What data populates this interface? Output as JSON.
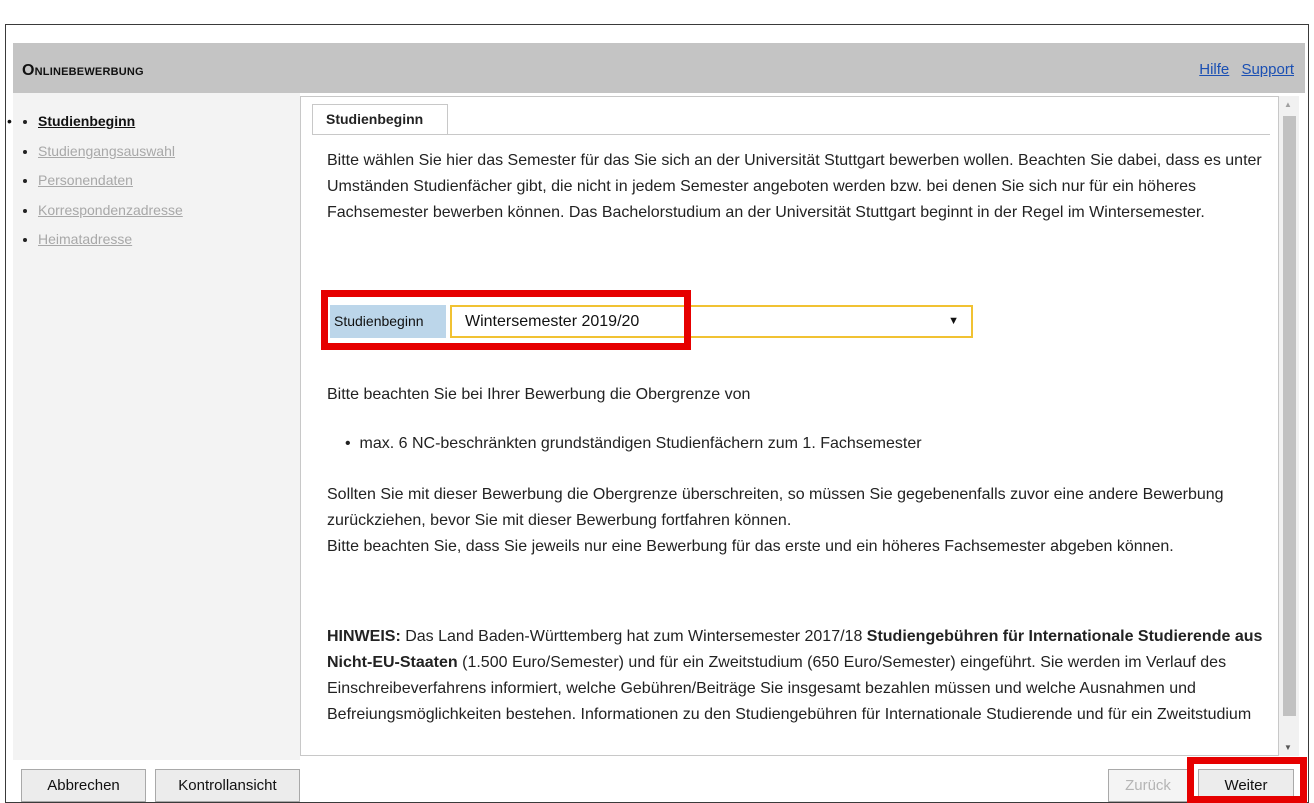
{
  "app": {
    "title": "Onlinebewerbung"
  },
  "links": {
    "help": "Hilfe",
    "support": "Support"
  },
  "sidebar": {
    "bullet": "•",
    "items": [
      {
        "label": "Studienbeginn",
        "state": "active"
      },
      {
        "label": "Studiengangsauswahl",
        "state": "inactive"
      },
      {
        "label": "Personendaten",
        "state": "inactive"
      },
      {
        "label": "Korrespondenzadresse",
        "state": "inactive"
      },
      {
        "label": "Heimatadresse",
        "state": "inactive"
      }
    ]
  },
  "content": {
    "tab": "Studienbeginn",
    "intro": "Bitte wählen Sie hier das Semester für das Sie sich an der Universität Stuttgart bewerben wollen. Beachten Sie dabei, dass es unter Umständen Studienfächer gibt, die nicht in jedem Semester angeboten werden bzw. bei denen Sie sich nur für ein höheres Fachsemester bewerben können. Das Bachelorstudium an der Universität Stuttgart beginnt in der Regel im Wintersemester.",
    "select": {
      "label": "Studienbeginn",
      "value": "Wintersemester 2019/20",
      "arrow": "▼"
    },
    "limit_intro": "Bitte beachten Sie bei Ihrer Bewerbung die Obergrenze von",
    "limit_item_bullet": "•",
    "limit_item": "max. 6 NC-beschränkten grundständigen Studienfächern zum 1. Fachsemester",
    "exceed_text": "Sollten Sie mit dieser Bewerbung die Obergrenze überschreiten, so müssen Sie gegebenenfalls zuvor eine andere Bewerbung zurückziehen, bevor Sie mit dieser Bewerbung fortfahren können.",
    "one_app_text": "Bitte beachten Sie, dass Sie jeweils nur eine Bewerbung für das erste und ein höheres Fachsemester abgeben können.",
    "hint": {
      "label": "HINWEIS:",
      "part1": " Das Land Baden-Württemberg hat zum Wintersemester 2017/18 ",
      "bold": "Studiengebühren für Internationale Studierende aus Nicht-EU-Staaten",
      "part2": " (1.500 Euro/Semester) und für ein Zweitstudium (650 Euro/Semester) eingeführt. Sie werden im Verlauf des Einschreibeverfahrens informiert, welche Gebühren/Beiträge Sie insgesamt bezahlen müssen und welche Ausnahmen und Befreiungsmöglichkeiten bestehen. Informationen zu den Studiengebühren für Internationale Studierende und für ein Zweitstudium"
    }
  },
  "scrollbar": {
    "up": "▲",
    "down": "▼"
  },
  "buttons": {
    "cancel": "Abbrechen",
    "review": "Kontrollansicht",
    "back": "Zurück",
    "next": "Weiter"
  },
  "colors": {
    "highlight": "#e60000",
    "select_border": "#f1c232",
    "label_bg": "#bcd6ea",
    "link": "#1a4fb3"
  }
}
